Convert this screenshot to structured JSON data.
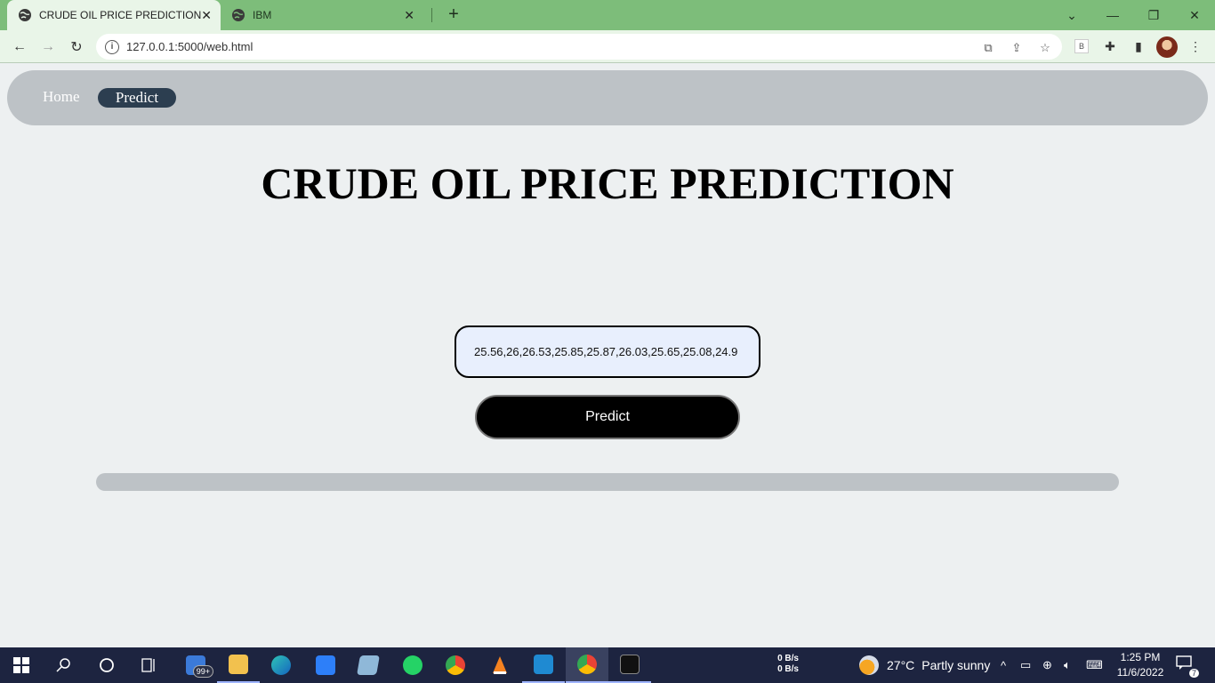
{
  "browser": {
    "tabs": [
      {
        "title": "CRUDE OIL PRICE PREDICTION",
        "active": true
      },
      {
        "title": "IBM",
        "active": false
      }
    ],
    "url": "127.0.0.1:5000/web.html",
    "extension_label": "B"
  },
  "nav": {
    "home_label": "Home",
    "predict_label": "Predict"
  },
  "page": {
    "title": "CRUDE OIL PRICE PREDICTION",
    "input_value": "25.56,26,26.53,25.85,25.87,26.03,25.65,25.08,24.9",
    "predict_button_label": "Predict",
    "result_text": ""
  },
  "taskbar": {
    "mail_badge": "99+",
    "net_up": "0 B/s",
    "net_down": "0 B/s",
    "weather_temp": "27°C",
    "weather_desc": "Partly sunny",
    "time": "1:25 PM",
    "date": "11/6/2022",
    "notification_count": "7"
  },
  "colors": {
    "tabstrip": "#7dbd7a",
    "toolbar": "#e9f5e8",
    "navbar": "#bdc2c6",
    "nav_active": "#2c3e50",
    "page_bg": "#edf0f1",
    "button": "#000000",
    "taskbar": "#1d2440"
  }
}
